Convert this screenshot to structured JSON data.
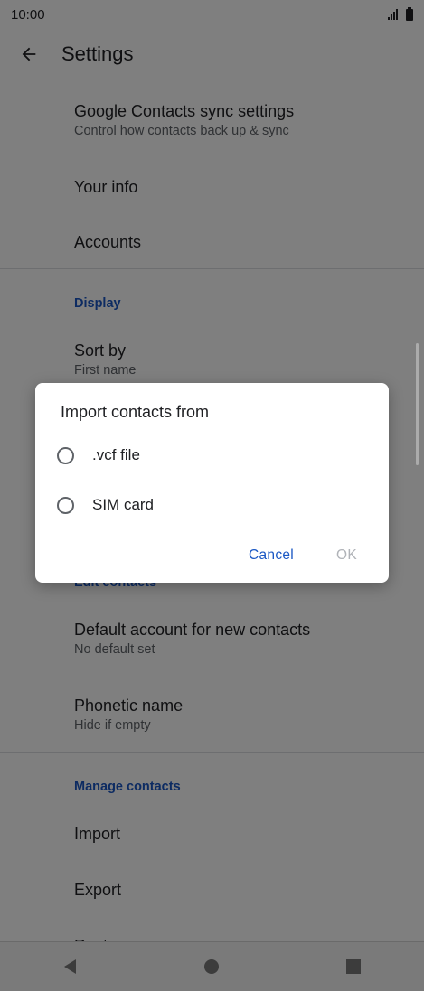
{
  "status": {
    "time": "10:00"
  },
  "appbar": {
    "title": "Settings"
  },
  "list": {
    "sync_title": "Google Contacts sync settings",
    "sync_sub": "Control how contacts back up & sync",
    "your_info": "Your info",
    "accounts": "Accounts",
    "display_header": "Display",
    "sort_title": "Sort by",
    "sort_sub": "First name",
    "edit_header": "Edit contacts",
    "default_title": "Default account for new contacts",
    "default_sub": "No default set",
    "phonetic_title": "Phonetic name",
    "phonetic_sub": "Hide if empty",
    "manage_header": "Manage contacts",
    "import": "Import",
    "export": "Export",
    "restore": "Restore"
  },
  "dialog": {
    "title": "Import contacts from",
    "options": [
      ".vcf file",
      "SIM card"
    ],
    "cancel": "Cancel",
    "ok": "OK"
  }
}
